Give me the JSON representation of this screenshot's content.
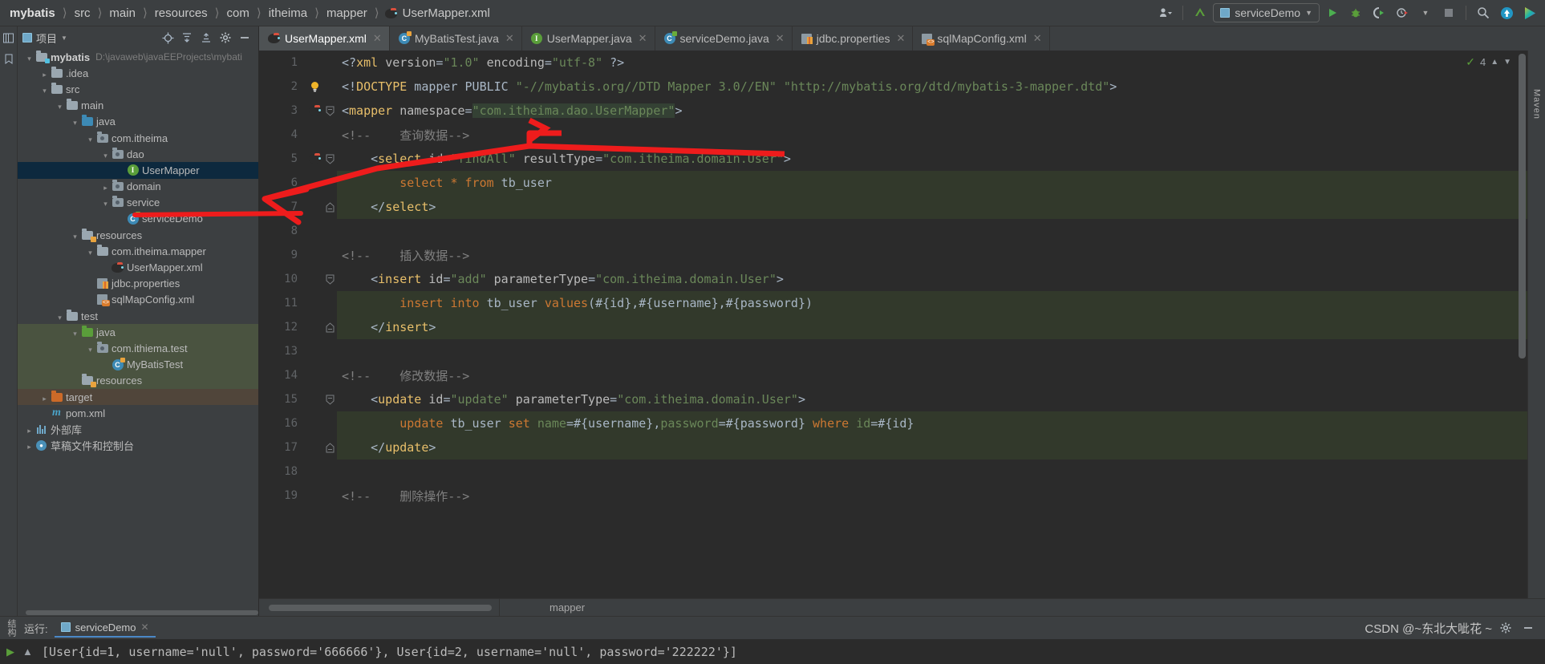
{
  "breadcrumb": {
    "items": [
      {
        "label": "mybatis",
        "root": true
      },
      {
        "label": "src"
      },
      {
        "label": "main"
      },
      {
        "label": "resources"
      },
      {
        "label": "com"
      },
      {
        "label": "itheima"
      },
      {
        "label": "mapper"
      },
      {
        "label": "UserMapper.xml",
        "icon": "mybatis-icon"
      }
    ]
  },
  "toolbar": {
    "user_icon": "user-icon",
    "vcs_update_icon": "vcs-update-icon",
    "run_config_name": "serviceDemo",
    "run_icon": "run-icon",
    "debug_icon": "debug-icon",
    "run_coverage_icon": "run-with-coverage-icon",
    "profiler_icon": "profiler-icon",
    "stop_icon": "stop-icon",
    "search_icon": "search-icon",
    "updates_icon": "updates-icon",
    "ide_icon": "ide-logo-icon"
  },
  "project_panel": {
    "title": "项目",
    "actions": [
      "locate-icon",
      "expand-all-icon",
      "collapse-all-icon",
      "settings-icon",
      "hide-icon"
    ],
    "tree": [
      {
        "depth": 0,
        "arrow": "down",
        "icon": "module-folder",
        "label": "mybatis",
        "bold": true,
        "path": "D:\\javaweb\\javaEEProjects\\mybati",
        "state": "normal"
      },
      {
        "depth": 1,
        "arrow": "right",
        "icon": "folder-grey",
        "label": ".idea",
        "state": "normal"
      },
      {
        "depth": 1,
        "arrow": "down",
        "icon": "folder-grey",
        "label": "src",
        "state": "normal"
      },
      {
        "depth": 2,
        "arrow": "down",
        "icon": "folder-grey",
        "label": "main",
        "state": "normal"
      },
      {
        "depth": 3,
        "arrow": "down",
        "icon": "folder-blue",
        "label": "java",
        "state": "normal"
      },
      {
        "depth": 4,
        "arrow": "down",
        "icon": "package",
        "label": "com.itheima",
        "state": "normal"
      },
      {
        "depth": 5,
        "arrow": "down",
        "icon": "package",
        "label": "dao",
        "state": "normal"
      },
      {
        "depth": 6,
        "arrow": "none",
        "icon": "interface",
        "label": "UserMapper",
        "state": "selected"
      },
      {
        "depth": 5,
        "arrow": "right",
        "icon": "package",
        "label": "domain",
        "state": "normal"
      },
      {
        "depth": 5,
        "arrow": "down",
        "icon": "package",
        "label": "service",
        "state": "normal"
      },
      {
        "depth": 6,
        "arrow": "none",
        "icon": "class",
        "label": "serviceDemo",
        "state": "normal"
      },
      {
        "depth": 3,
        "arrow": "down",
        "icon": "folder-res",
        "label": "resources",
        "state": "normal"
      },
      {
        "depth": 4,
        "arrow": "down",
        "icon": "folder-grey",
        "label": "com.itheima.mapper",
        "state": "normal"
      },
      {
        "depth": 5,
        "arrow": "none",
        "icon": "mybatis-file",
        "label": "UserMapper.xml",
        "state": "normal"
      },
      {
        "depth": 4,
        "arrow": "none",
        "icon": "properties",
        "label": "jdbc.properties",
        "state": "normal"
      },
      {
        "depth": 4,
        "arrow": "none",
        "icon": "xml-file",
        "label": "sqlMapConfig.xml",
        "state": "normal"
      },
      {
        "depth": 2,
        "arrow": "down",
        "icon": "folder-grey",
        "label": "test",
        "state": "normal"
      },
      {
        "depth": 3,
        "arrow": "down",
        "icon": "folder-green",
        "label": "java",
        "state": "test"
      },
      {
        "depth": 4,
        "arrow": "down",
        "icon": "package",
        "label": "com.ithiema.test",
        "state": "test"
      },
      {
        "depth": 5,
        "arrow": "none",
        "icon": "class-test",
        "label": "MyBatisTest",
        "state": "test"
      },
      {
        "depth": 3,
        "arrow": "none",
        "icon": "folder-testres",
        "label": "resources",
        "state": "test"
      },
      {
        "depth": 1,
        "arrow": "right",
        "icon": "folder-orange",
        "label": "target",
        "state": "target"
      },
      {
        "depth": 1,
        "arrow": "none",
        "icon": "maven",
        "label": "pom.xml",
        "state": "normal"
      },
      {
        "depth": 0,
        "arrow": "right",
        "icon": "library",
        "label": "外部库",
        "state": "normal"
      },
      {
        "depth": 0,
        "arrow": "right",
        "icon": "console",
        "label": "草稿文件和控制台",
        "state": "normal"
      }
    ]
  },
  "tabs": [
    {
      "label": "UserMapper.xml",
      "icon": "mybatis-file",
      "active": true
    },
    {
      "label": "MyBatisTest.java",
      "icon": "class-test",
      "active": false
    },
    {
      "label": "UserMapper.java",
      "icon": "interface",
      "active": false
    },
    {
      "label": "serviceDemo.java",
      "icon": "class",
      "active": false
    },
    {
      "label": "jdbc.properties",
      "icon": "properties",
      "active": false
    },
    {
      "label": "sqlMapConfig.xml",
      "icon": "xml-file",
      "active": false
    }
  ],
  "editor": {
    "inspections": {
      "count": "4",
      "check_icon": "inspection-ok-icon"
    },
    "lines": [
      {
        "num": "1",
        "marker": "",
        "fold": "",
        "highlight": false,
        "tokens": [
          {
            "t": "punct",
            "v": "<?"
          },
          {
            "t": "tag",
            "v": "xml"
          },
          {
            "t": "plain",
            "v": " "
          },
          {
            "t": "attr",
            "v": "version"
          },
          {
            "t": "punct",
            "v": "="
          },
          {
            "t": "str",
            "v": "\"1.0\""
          },
          {
            "t": "plain",
            "v": " "
          },
          {
            "t": "attr",
            "v": "encoding"
          },
          {
            "t": "punct",
            "v": "="
          },
          {
            "t": "str",
            "v": "\"utf-8\""
          },
          {
            "t": "plain",
            "v": " "
          },
          {
            "t": "punct",
            "v": "?>"
          }
        ]
      },
      {
        "num": "2",
        "marker": "bulb",
        "fold": "",
        "highlight": false,
        "tokens": [
          {
            "t": "punct",
            "v": "<!"
          },
          {
            "t": "tag",
            "v": "DOCTYPE"
          },
          {
            "t": "plain",
            "v": " mapper PUBLIC "
          },
          {
            "t": "str",
            "v": "\"-//mybatis.org//DTD Mapper 3.0//EN\""
          },
          {
            "t": "plain",
            "v": " "
          },
          {
            "t": "str",
            "v": "\"http://mybatis.org/dtd/mybatis-3-mapper.dtd\""
          },
          {
            "t": "punct",
            "v": ">"
          }
        ]
      },
      {
        "num": "3",
        "marker": "mybatis",
        "fold": "minus",
        "highlight": false,
        "tokens": [
          {
            "t": "punct",
            "v": "<"
          },
          {
            "t": "tag",
            "v": "mapper"
          },
          {
            "t": "plain",
            "v": " "
          },
          {
            "t": "attr",
            "v": "namespace"
          },
          {
            "t": "punct",
            "v": "="
          },
          {
            "t": "ns",
            "v": "\"com.itheima.dao.UserMapper\""
          },
          {
            "t": "punct",
            "v": ">"
          }
        ]
      },
      {
        "num": "4",
        "marker": "",
        "fold": "",
        "highlight": false,
        "tokens": [
          {
            "t": "comment",
            "v": "<!--    查询数据-->"
          }
        ]
      },
      {
        "num": "5",
        "marker": "mybatis",
        "fold": "minus",
        "highlight": false,
        "indent": 1,
        "tokens": [
          {
            "t": "punct",
            "v": "<"
          },
          {
            "t": "tag",
            "v": "select"
          },
          {
            "t": "plain",
            "v": " "
          },
          {
            "t": "attr",
            "v": "id"
          },
          {
            "t": "punct",
            "v": "="
          },
          {
            "t": "str",
            "v": "\"findAll\""
          },
          {
            "t": "plain",
            "v": " "
          },
          {
            "t": "attr",
            "v": "resultType"
          },
          {
            "t": "punct",
            "v": "="
          },
          {
            "t": "str",
            "v": "\"com.itheima.domain.User\""
          },
          {
            "t": "punct",
            "v": ">"
          }
        ]
      },
      {
        "num": "6",
        "marker": "",
        "fold": "",
        "highlight": true,
        "indent": 2,
        "tokens": [
          {
            "t": "sqlword",
            "v": "select"
          },
          {
            "t": "plain",
            "v": " "
          },
          {
            "t": "sqlword",
            "v": "*"
          },
          {
            "t": "plain",
            "v": " "
          },
          {
            "t": "sqlword",
            "v": "from"
          },
          {
            "t": "plain",
            "v": " tb_user"
          }
        ]
      },
      {
        "num": "7",
        "marker": "",
        "fold": "minus2",
        "highlight": true,
        "indent": 1,
        "tokens": [
          {
            "t": "punct",
            "v": "</"
          },
          {
            "t": "tag",
            "v": "select"
          },
          {
            "t": "punct",
            "v": ">"
          }
        ]
      },
      {
        "num": "8",
        "marker": "",
        "fold": "",
        "highlight": false,
        "tokens": []
      },
      {
        "num": "9",
        "marker": "",
        "fold": "",
        "highlight": false,
        "tokens": [
          {
            "t": "comment",
            "v": "<!--    插入数据-->"
          }
        ]
      },
      {
        "num": "10",
        "marker": "",
        "fold": "minus",
        "highlight": false,
        "indent": 1,
        "tokens": [
          {
            "t": "punct",
            "v": "<"
          },
          {
            "t": "tag",
            "v": "insert"
          },
          {
            "t": "plain",
            "v": " "
          },
          {
            "t": "attr",
            "v": "id"
          },
          {
            "t": "punct",
            "v": "="
          },
          {
            "t": "str",
            "v": "\"add\""
          },
          {
            "t": "plain",
            "v": " "
          },
          {
            "t": "attr",
            "v": "parameterType"
          },
          {
            "t": "punct",
            "v": "="
          },
          {
            "t": "str",
            "v": "\"com.itheima.domain.User\""
          },
          {
            "t": "punct",
            "v": ">"
          }
        ]
      },
      {
        "num": "11",
        "marker": "",
        "fold": "",
        "highlight": true,
        "indent": 2,
        "tokens": [
          {
            "t": "sqlword",
            "v": "insert"
          },
          {
            "t": "plain",
            "v": " "
          },
          {
            "t": "sqlword",
            "v": "into"
          },
          {
            "t": "plain",
            "v": " tb_user "
          },
          {
            "t": "sqlword",
            "v": "values"
          },
          {
            "t": "plain",
            "v": "(#{id},#{username},#{password})"
          }
        ]
      },
      {
        "num": "12",
        "marker": "",
        "fold": "minus2",
        "highlight": true,
        "indent": 1,
        "tokens": [
          {
            "t": "punct",
            "v": "</"
          },
          {
            "t": "tag",
            "v": "insert"
          },
          {
            "t": "punct",
            "v": ">"
          }
        ]
      },
      {
        "num": "13",
        "marker": "",
        "fold": "",
        "highlight": false,
        "tokens": []
      },
      {
        "num": "14",
        "marker": "",
        "fold": "",
        "highlight": false,
        "tokens": [
          {
            "t": "comment",
            "v": "<!--    修改数据-->"
          }
        ]
      },
      {
        "num": "15",
        "marker": "",
        "fold": "minus",
        "highlight": false,
        "indent": 1,
        "tokens": [
          {
            "t": "punct",
            "v": "<"
          },
          {
            "t": "tag",
            "v": "update"
          },
          {
            "t": "plain",
            "v": " "
          },
          {
            "t": "attr",
            "v": "id"
          },
          {
            "t": "punct",
            "v": "="
          },
          {
            "t": "str",
            "v": "\"update\""
          },
          {
            "t": "plain",
            "v": " "
          },
          {
            "t": "attr",
            "v": "parameterType"
          },
          {
            "t": "punct",
            "v": "="
          },
          {
            "t": "str",
            "v": "\"com.itheima.domain.User\""
          },
          {
            "t": "punct",
            "v": ">"
          }
        ]
      },
      {
        "num": "16",
        "marker": "",
        "fold": "",
        "highlight": true,
        "indent": 2,
        "tokens": [
          {
            "t": "sqlword",
            "v": "update"
          },
          {
            "t": "plain",
            "v": " tb_user "
          },
          {
            "t": "sqlword",
            "v": "set"
          },
          {
            "t": "plain",
            "v": " "
          },
          {
            "t": "val",
            "v": "name"
          },
          {
            "t": "punct",
            "v": "=#{username},"
          },
          {
            "t": "val",
            "v": "password"
          },
          {
            "t": "punct",
            "v": "=#{password} "
          },
          {
            "t": "sqlword",
            "v": "where"
          },
          {
            "t": "plain",
            "v": " "
          },
          {
            "t": "val",
            "v": "id"
          },
          {
            "t": "punct",
            "v": "=#{id}"
          }
        ]
      },
      {
        "num": "17",
        "marker": "",
        "fold": "minus2",
        "highlight": true,
        "indent": 1,
        "tokens": [
          {
            "t": "punct",
            "v": "</"
          },
          {
            "t": "tag",
            "v": "update"
          },
          {
            "t": "punct",
            "v": ">"
          }
        ]
      },
      {
        "num": "18",
        "marker": "",
        "fold": "",
        "highlight": false,
        "tokens": []
      },
      {
        "num": "19",
        "marker": "",
        "fold": "",
        "highlight": false,
        "tokens": [
          {
            "t": "comment",
            "v": "<!--    删除操作-->"
          }
        ]
      }
    ],
    "status_breadcrumb": "mapper"
  },
  "run_panel": {
    "label": "运行:",
    "tab_name": "serviceDemo",
    "console_output": "[User{id=1, username='null', password='666666'}, User{id=2, username='null', password='222222'}]",
    "rerun_icon": "rerun-icon",
    "stop_icon": "stop-icon",
    "settings_icon": "settings-icon",
    "hide_icon": "hide-icon"
  },
  "left_rail": {
    "structure_label": "结构",
    "project_label": "项目"
  },
  "right_rail": {
    "maven_label": "Maven"
  },
  "watermark": "CSDN @~东北大呲花 ~",
  "colors": {
    "accent_blue": "#4a88c7",
    "selection": "#0d293e",
    "test_scope": "#4a5340",
    "target_scope": "#50453a",
    "sql_highlight": "#32392b",
    "annotation_red": "#ee1c1c"
  }
}
